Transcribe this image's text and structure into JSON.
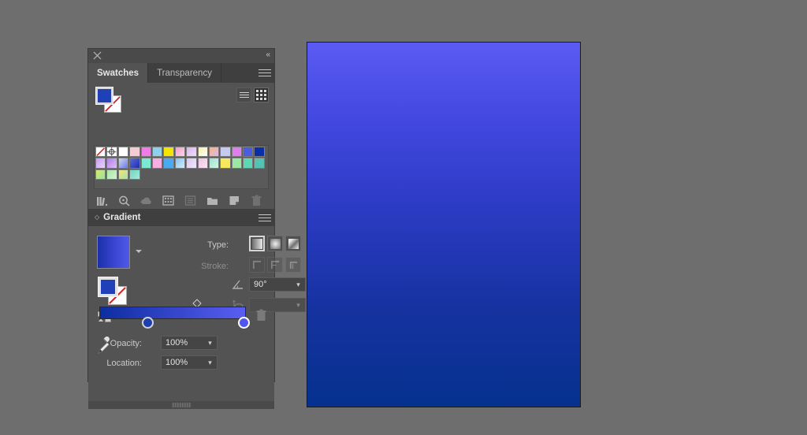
{
  "app": {
    "canvas_background": "#6e6e6e"
  },
  "panel_stack": {
    "titlebar": {
      "close_icon": "close-icon",
      "collapse_label": "«"
    },
    "tabs": [
      {
        "label": "Swatches",
        "active": true
      },
      {
        "label": "Transparency",
        "active": false
      }
    ],
    "tab_menu_icon": "hamburger-menu-icon"
  },
  "swatches_panel": {
    "fill_color": "#2040b8",
    "stroke_color": "none",
    "view_modes": [
      {
        "name": "list-view",
        "active": false
      },
      {
        "name": "grid-view",
        "active": true
      }
    ],
    "swatches": [
      {
        "name": "none",
        "type": "none",
        "color": "#ffffff"
      },
      {
        "name": "registration",
        "type": "registration",
        "color": "#ffffff"
      },
      {
        "name": "white",
        "type": "solid",
        "color": "#ffffff"
      },
      {
        "name": "pale-pink",
        "type": "solid",
        "color": "#f5ccd3"
      },
      {
        "name": "magenta-pink",
        "type": "solid",
        "color": "#f07ce8"
      },
      {
        "name": "sky-blue",
        "type": "solid",
        "color": "#8fd0ea"
      },
      {
        "name": "yellow",
        "type": "solid",
        "color": "#f5e400"
      },
      {
        "name": "pink-rose",
        "type": "gradient",
        "color": "#f79ccf",
        "color2": "#fbd4e6"
      },
      {
        "name": "lilac",
        "type": "gradient",
        "color": "#d9b6f0",
        "color2": "#efdcf8"
      },
      {
        "name": "yellow-white",
        "type": "gradient",
        "color": "#f4f0a8",
        "color2": "#ffffff"
      },
      {
        "name": "peach-lilac",
        "type": "gradient",
        "color": "#f7b57e",
        "color2": "#d9b9ef"
      },
      {
        "name": "periwinkle",
        "type": "solid",
        "color": "#c6c9f2"
      },
      {
        "name": "orchid",
        "type": "solid",
        "color": "#e07ef0"
      },
      {
        "name": "royal-blue",
        "type": "solid",
        "color": "#4a5ce0"
      },
      {
        "name": "navy",
        "type": "solid",
        "color": "#0a2da8"
      },
      {
        "name": "violet-fade",
        "type": "gradient",
        "color": "#c69cf0",
        "color2": "#e7d5fa"
      },
      {
        "name": "purple-fade",
        "type": "gradient",
        "color": "#b07ce8",
        "color2": "#dcc0f5"
      },
      {
        "name": "blue-white",
        "type": "gradient",
        "color": "#cfd6f5",
        "color2": "#6b7ae0"
      },
      {
        "name": "blue-deep",
        "type": "gradient",
        "color": "#5a6ae0",
        "color2": "#1d2fa8"
      },
      {
        "name": "aqua",
        "type": "solid",
        "color": "#7ce8d2"
      },
      {
        "name": "pink-light",
        "type": "solid",
        "color": "#f5aee0"
      },
      {
        "name": "azure",
        "type": "solid",
        "color": "#4aaaf0"
      },
      {
        "name": "blue-cyan-fade",
        "type": "gradient",
        "color": "#7fc6f0",
        "color2": "#d7eaf8"
      },
      {
        "name": "lavender-fade",
        "type": "gradient",
        "color": "#d9c6f2",
        "color2": "#f0e8fa"
      },
      {
        "name": "pink-pale-fade",
        "type": "gradient",
        "color": "#f0c2e2",
        "color2": "#f8e6f2"
      },
      {
        "name": "teal-aqua",
        "type": "gradient",
        "color": "#9ee2cf",
        "color2": "#d4f2e8"
      },
      {
        "name": "lemon",
        "type": "solid",
        "color": "#f7e85c"
      },
      {
        "name": "mint-green",
        "type": "solid",
        "color": "#9ce8a0"
      },
      {
        "name": "sea-green",
        "type": "solid",
        "color": "#5cd8b4"
      },
      {
        "name": "teal",
        "type": "solid",
        "color": "#56c2b4"
      },
      {
        "name": "yellow-green-fade",
        "type": "gradient",
        "color": "#dbe86a",
        "color2": "#9ce0a8"
      },
      {
        "name": "green-pale",
        "type": "gradient",
        "color": "#a8e8a8",
        "color2": "#d4f2cf"
      },
      {
        "name": "lime-yellow",
        "type": "gradient",
        "color": "#f0e86a",
        "color2": "#a8e0b4"
      },
      {
        "name": "teal-light",
        "type": "gradient",
        "color": "#6cd8c0",
        "color2": "#a8e8dc"
      }
    ],
    "toolbar_icons": [
      {
        "name": "swatch-libraries-icon",
        "dim": false
      },
      {
        "name": "show-swatch-kinds-icon",
        "dim": false
      },
      {
        "name": "add-to-library-icon",
        "dim": true
      },
      {
        "name": "new-color-group-icon",
        "dim": false
      },
      {
        "name": "swatch-options-icon",
        "dim": true
      },
      {
        "name": "new-color-group-folder-icon",
        "dim": false
      },
      {
        "name": "new-swatch-icon",
        "dim": false
      },
      {
        "name": "delete-swatch-icon",
        "dim": true
      }
    ]
  },
  "gradient_panel": {
    "title": "Gradient",
    "collapse_arrow": "◇",
    "menu_icon": "hamburger-menu-icon",
    "preview_name": "gradient-swatch-preview",
    "fill_color": "#2040b8",
    "type": {
      "label": "Type:",
      "options": [
        {
          "name": "linear-gradient-type",
          "active": true
        },
        {
          "name": "radial-gradient-type",
          "active": false
        },
        {
          "name": "freeform-gradient-type",
          "active": false
        }
      ]
    },
    "stroke": {
      "label": "Stroke:",
      "disabled": true,
      "options": [
        {
          "name": "stroke-apply-within",
          "active": false
        },
        {
          "name": "stroke-apply-along",
          "active": false
        },
        {
          "name": "stroke-apply-across",
          "active": false
        }
      ]
    },
    "angle": {
      "icon": "angle-icon",
      "value": "90°",
      "disabled": false
    },
    "aspect_ratio": {
      "icon": "aspect-ratio-icon",
      "value": "",
      "disabled": true
    },
    "slider": {
      "start_color": "#0d2da0",
      "end_color": "#5a5ef2",
      "midpoint_marker": "gradient-midpoint-diamond",
      "stops": [
        {
          "name": "gradient-stop-start",
          "position_pct": 33,
          "color": "#1d3fb0",
          "selected": false
        },
        {
          "name": "gradient-stop-end",
          "position_pct": 100,
          "color": "#5057ee",
          "selected": true
        }
      ],
      "delete_icon": "delete-stop-icon"
    },
    "opacity": {
      "label": "Opacity:",
      "value": "100%"
    },
    "location": {
      "label": "Location:",
      "value": "100%"
    },
    "eyedropper_icon": "eyedropper-icon"
  },
  "artboard": {
    "name": "gradient-artwork",
    "gradient_top": "#5a5bf2",
    "gradient_bottom": "#05318f",
    "angle": "90°"
  }
}
